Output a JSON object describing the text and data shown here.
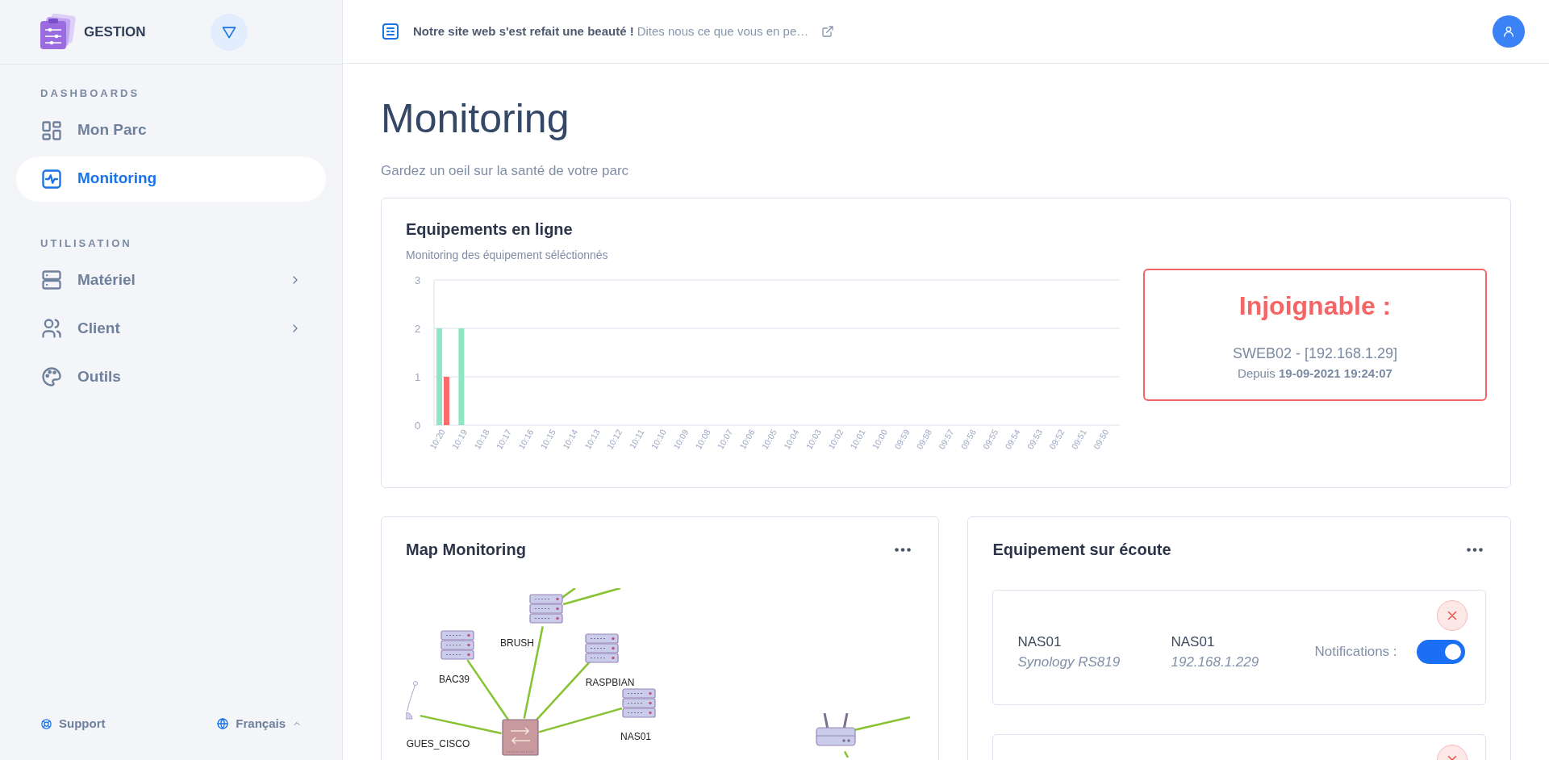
{
  "brand": {
    "name": "GESTION"
  },
  "sidebar": {
    "sections": [
      {
        "title": "DASHBOARDS",
        "items": [
          {
            "label": "Mon Parc",
            "selected": false,
            "has_submenu": false
          },
          {
            "label": "Monitoring",
            "selected": true,
            "has_submenu": false
          }
        ]
      },
      {
        "title": "UTILISATION",
        "items": [
          {
            "label": "Matériel",
            "selected": false,
            "has_submenu": true
          },
          {
            "label": "Client",
            "selected": false,
            "has_submenu": true
          },
          {
            "label": "Outils",
            "selected": false,
            "has_submenu": false
          }
        ]
      }
    ],
    "footer": {
      "support": "Support",
      "language": "Français"
    }
  },
  "banner": {
    "headline": "Notre site web s'est refait une beauté !",
    "text": "Dites nous ce que vous en pe…"
  },
  "page": {
    "title": "Monitoring",
    "subtitle": "Gardez un oeil sur la santé de votre parc"
  },
  "online_card": {
    "title": "Equipements en ligne",
    "subtitle": "Monitoring des équipement séléctionnés",
    "chart_data": {
      "type": "bar",
      "categories": [
        "10:20",
        "10:19",
        "10:18",
        "10:17",
        "10:16",
        "10:15",
        "10:14",
        "10:13",
        "10:12",
        "10:11",
        "10:10",
        "10:09",
        "10:08",
        "10:07",
        "10:06",
        "10:05",
        "10:04",
        "10:03",
        "10:02",
        "10:01",
        "10:00",
        "09:59",
        "09:58",
        "09:57",
        "09:56",
        "09:55",
        "09:54",
        "09:53",
        "09:52",
        "09:51",
        "09:50"
      ],
      "series": [
        {
          "color": "#8ee6c4",
          "values": [
            2,
            2,
            0,
            0,
            0,
            0,
            0,
            0,
            0,
            0,
            0,
            0,
            0,
            0,
            0,
            0,
            0,
            0,
            0,
            0,
            0,
            0,
            0,
            0,
            0,
            0,
            0,
            0,
            0,
            0,
            0
          ]
        },
        {
          "color": "#ff6b6b",
          "values": [
            1,
            0,
            0,
            0,
            0,
            0,
            0,
            0,
            0,
            0,
            0,
            0,
            0,
            0,
            0,
            0,
            0,
            0,
            0,
            0,
            0,
            0,
            0,
            0,
            0,
            0,
            0,
            0,
            0,
            0,
            0
          ]
        }
      ],
      "ylim": [
        0,
        3
      ],
      "yticks": [
        0,
        1,
        2,
        3
      ]
    },
    "alert": {
      "title": "Injoignable :",
      "device": "SWEB02 - [192.168.1.29]",
      "since": "Depuis **19-09-2021 19:24:07**"
    }
  },
  "map_card": {
    "title": "Map Monitoring",
    "nodes": [
      {
        "label": "BRUSH",
        "kind": "server"
      },
      {
        "label": "BAC39",
        "kind": "server"
      },
      {
        "label": "RASPBIAN",
        "kind": "server"
      },
      {
        "label": "NAS01",
        "kind": "server"
      },
      {
        "label": "GUES_CISCO",
        "kind": "antenna"
      },
      {
        "kind": "switch"
      },
      {
        "kind": "router"
      }
    ]
  },
  "listen_card": {
    "title": "Equipement sur écoute",
    "items": [
      {
        "kind": "full",
        "name": "NAS01",
        "model": "Synology RS819",
        "host": "NAS01",
        "ip": "192.168.1.229",
        "notifications_label": "Notifications :",
        "notifications": true
      },
      {
        "kind": "partial"
      }
    ]
  }
}
